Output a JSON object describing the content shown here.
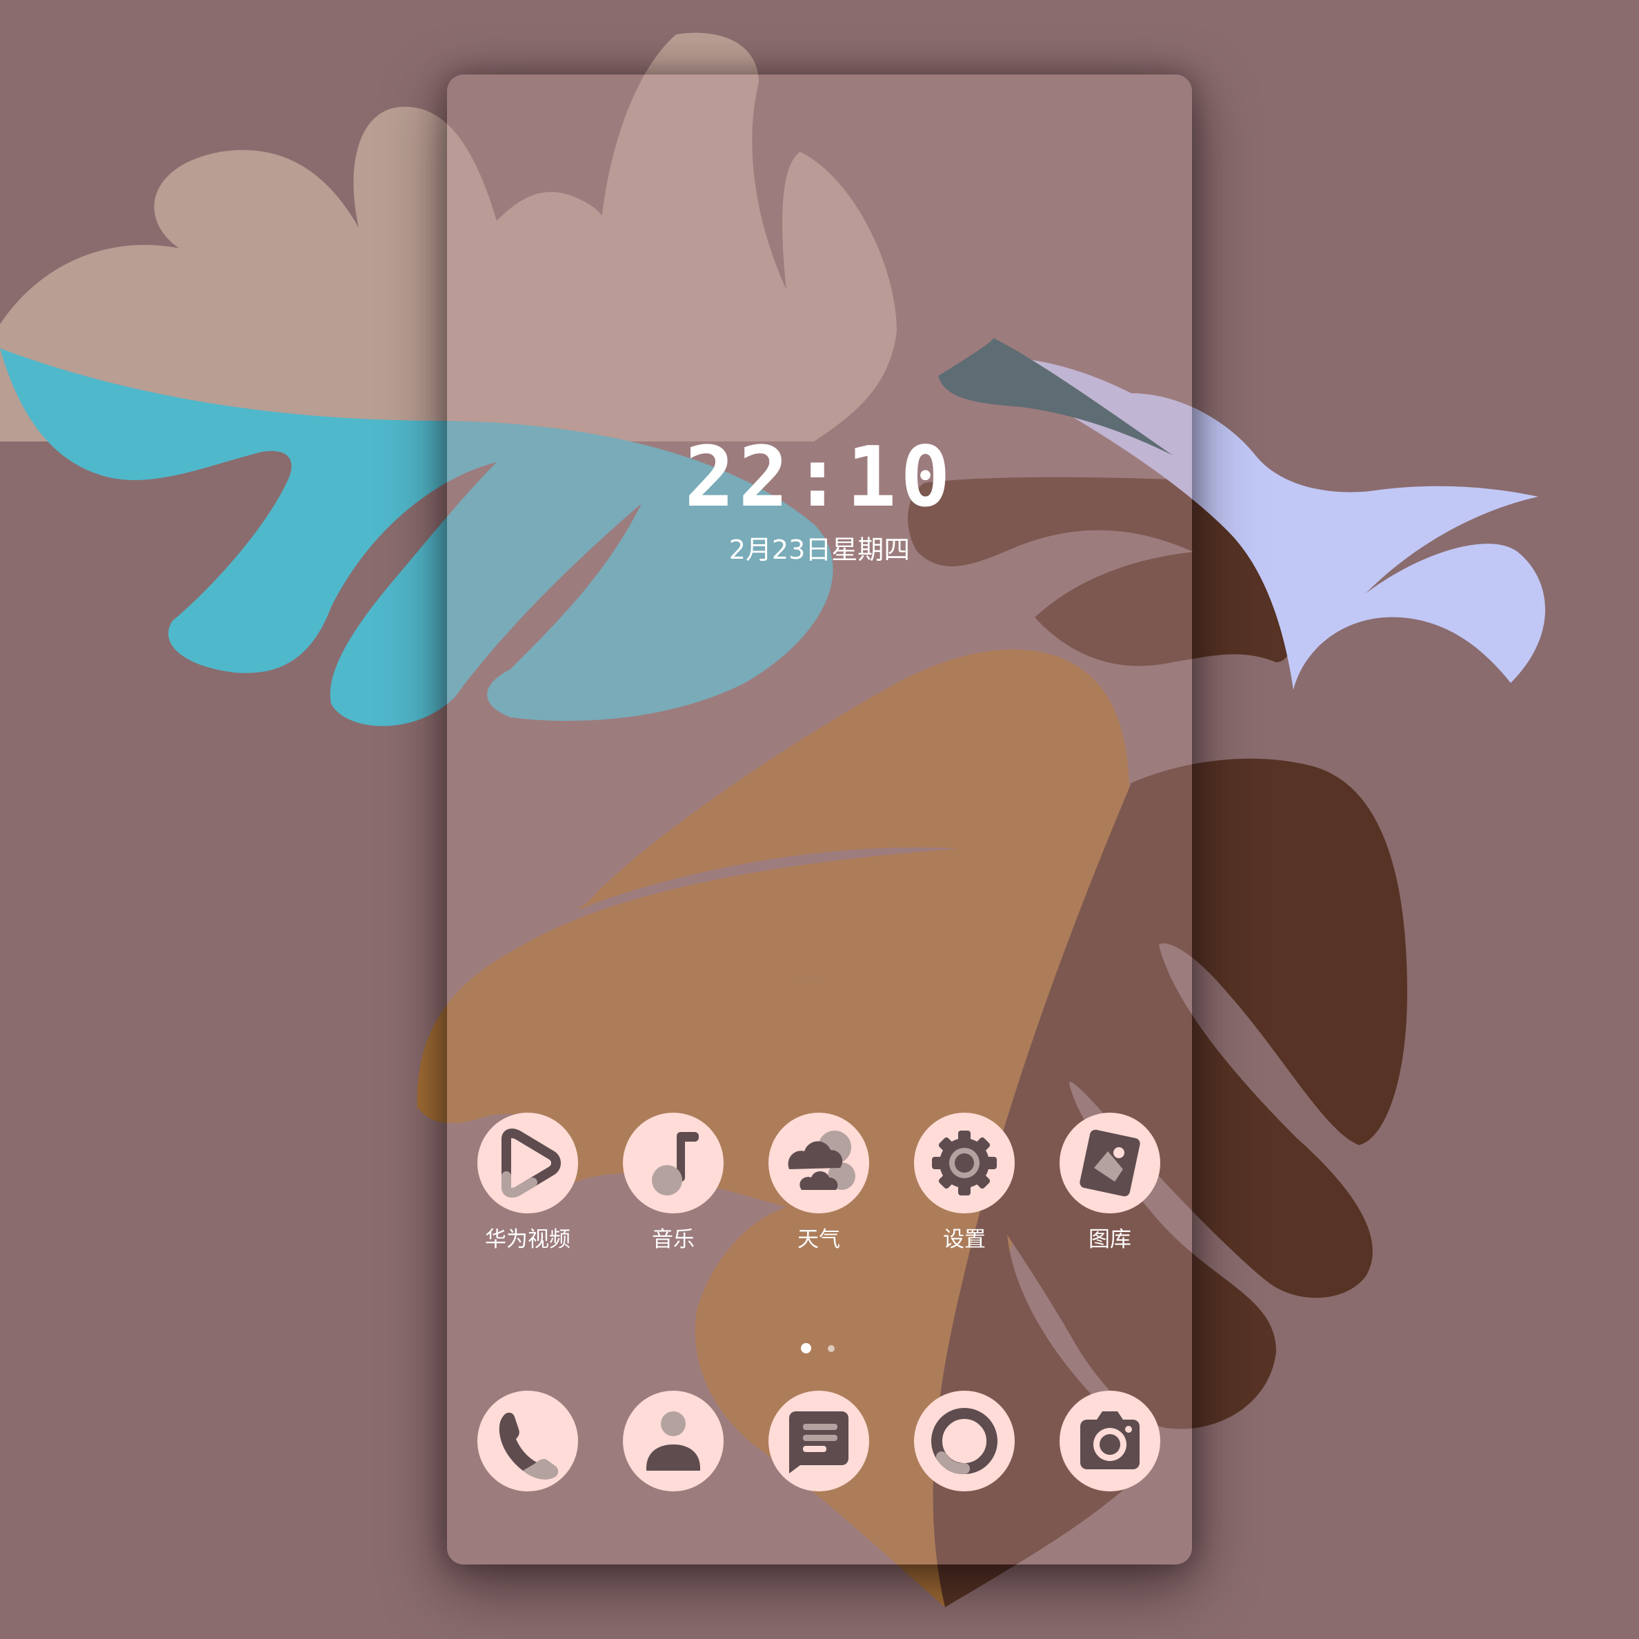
{
  "lockscreen": {
    "time": "22:10",
    "date": "2月23日星期四"
  },
  "apps": [
    {
      "label": "华为视频",
      "icon": "video-icon"
    },
    {
      "label": "音乐",
      "icon": "music-icon"
    },
    {
      "label": "天气",
      "icon": "weather-icon"
    },
    {
      "label": "设置",
      "icon": "gear-icon"
    },
    {
      "label": "图库",
      "icon": "gallery-icon"
    }
  ],
  "dock": [
    {
      "icon": "phone-icon"
    },
    {
      "icon": "contacts-icon"
    },
    {
      "icon": "messages-icon"
    },
    {
      "icon": "browser-icon"
    },
    {
      "icon": "camera-icon"
    }
  ],
  "page_indicator": {
    "pages": 2,
    "current": 1
  },
  "colors": {
    "background": "#8a6c6e",
    "icon_bg": "#ffdcd7",
    "icon_fg": "#5e4c4f",
    "leaf_teal": "#50b8cb",
    "leaf_tan": "#b89e93",
    "leaf_orange": "#a46f35",
    "leaf_brown": "#563324",
    "leaf_lavender": "#c2c8f6",
    "leaf_dark_teal": "#24535d"
  }
}
